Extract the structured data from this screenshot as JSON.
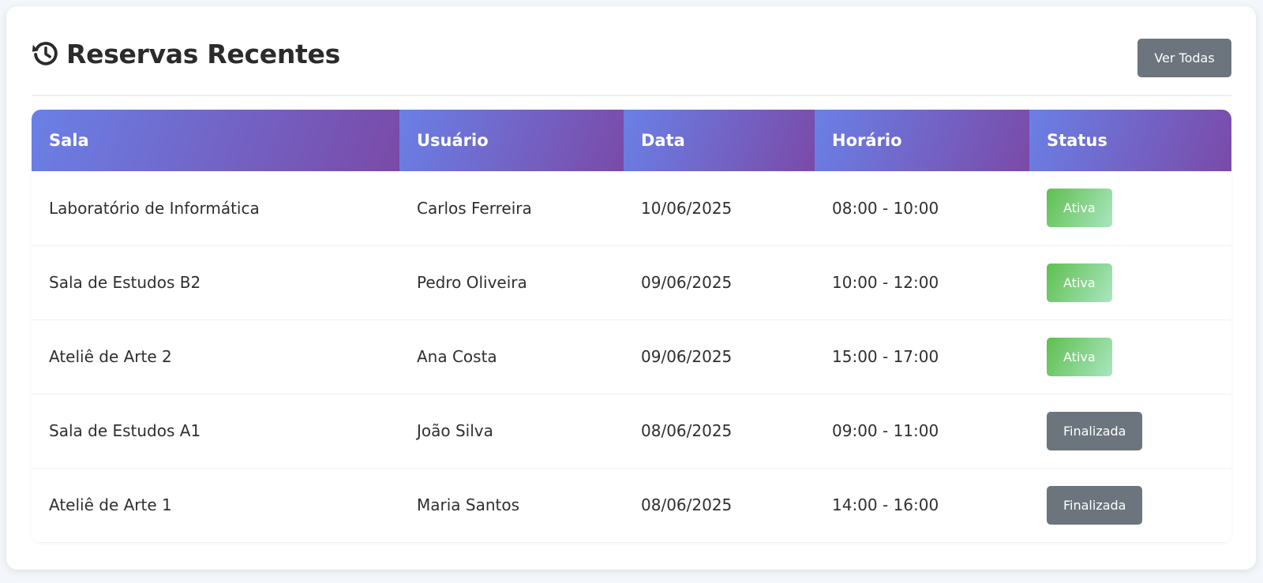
{
  "header": {
    "title": "Reservas Recentes",
    "title_icon": "history-icon",
    "view_all_label": "Ver Todas"
  },
  "table": {
    "columns": [
      "Sala",
      "Usuário",
      "Data",
      "Horário",
      "Status"
    ],
    "rows": [
      {
        "room": "Laboratório de Informática",
        "user": "Carlos Ferreira",
        "date": "10/06/2025",
        "time": "08:00 - 10:00",
        "status": "Ativa",
        "status_type": "active"
      },
      {
        "room": "Sala de Estudos B2",
        "user": "Pedro Oliveira",
        "date": "09/06/2025",
        "time": "10:00 - 12:00",
        "status": "Ativa",
        "status_type": "active"
      },
      {
        "room": "Ateliê de Arte 2",
        "user": "Ana Costa",
        "date": "09/06/2025",
        "time": "15:00 - 17:00",
        "status": "Ativa",
        "status_type": "active"
      },
      {
        "room": "Sala de Estudos A1",
        "user": "João Silva",
        "date": "08/06/2025",
        "time": "09:00 - 11:00",
        "status": "Finalizada",
        "status_type": "done"
      },
      {
        "room": "Ateliê de Arte 1",
        "user": "Maria Santos",
        "date": "08/06/2025",
        "time": "14:00 - 16:00",
        "status": "Finalizada",
        "status_type": "done"
      }
    ]
  },
  "colors": {
    "header_gradient_start": "#6a80e6",
    "header_gradient_end": "#7a4aa8",
    "active_badge": "#5fbf4f",
    "done_badge": "#6c757d",
    "view_all_button": "#6c757d"
  }
}
